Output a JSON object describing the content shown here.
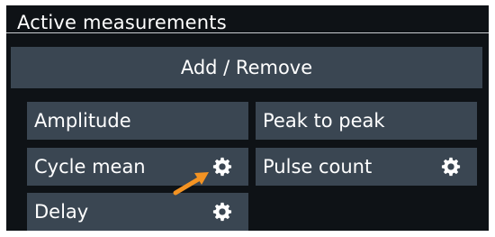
{
  "panel": {
    "title": "Active measurements",
    "add_remove_label": "Add / Remove"
  },
  "measurements": [
    {
      "label": "Amplitude",
      "has_settings": false
    },
    {
      "label": "Peak to peak",
      "has_settings": false
    },
    {
      "label": "Cycle mean",
      "has_settings": true
    },
    {
      "label": "Pulse count",
      "has_settings": true
    },
    {
      "label": "Delay",
      "has_settings": true
    }
  ],
  "icons": {
    "settings": "gear-icon",
    "pointer": "orange-arrow-icon"
  },
  "colors": {
    "panel_bg": "#0e1216",
    "button_bg": "#3a4652",
    "text": "#ffffff",
    "pointer": "#f39323"
  }
}
